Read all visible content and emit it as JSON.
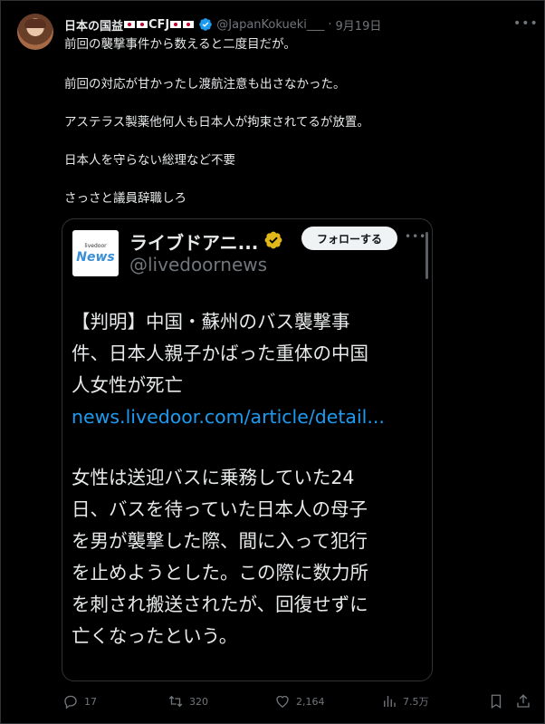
{
  "user": {
    "display_name": "日本の国益",
    "name_suffix": "CFJ",
    "handle": "@JapanKokueki___",
    "separator": "·",
    "time": "9月19日"
  },
  "tweet": {
    "lines": [
      "前回の襲撃事件から数えると二度目だが。",
      "前回の対応が甘かったし渡航注意も出さなかった。",
      "アステラス製薬他何人も日本人が拘束されてるが放置。",
      "日本人を守らない総理など不要",
      "さっさと議員辞職しろ"
    ]
  },
  "quoted": {
    "logo_top": "livedoor",
    "logo_main": "News",
    "name": "ライブドアニ...",
    "handle": "@livedoornews",
    "follow_label": "フォローする",
    "body_lines": [
      "【判明】中国・蘇州のバス襲撃事",
      "件、日本人親子かばった重体の中国",
      "人女性が死亡"
    ],
    "link": "news.livedoor.com/article/detail...",
    "body2_lines": [
      "女性は送迎バスに乗務していた24",
      "日、バスを待っていた日本人の母子",
      "を男が襲撃した際、間に入って犯行",
      "を止めようとした。この際に数力所",
      "を刺され搬送されたが、回復せずに",
      "亡くなったという。"
    ]
  },
  "actions": {
    "reply_count": "17",
    "retweet_count": "320",
    "like_count": "2,164",
    "view_count": "7.5万"
  },
  "colors": {
    "background": "#000000",
    "text": "#e7e9ea",
    "muted": "#71767b",
    "link": "#1d9bf0",
    "verified_blue": "#1d9bf0",
    "verified_gold": "#e2b719"
  },
  "icons": [
    "verified-badge-icon",
    "more-icon",
    "reply-icon",
    "retweet-icon",
    "like-icon",
    "views-icon",
    "bookmark-icon",
    "share-icon"
  ]
}
